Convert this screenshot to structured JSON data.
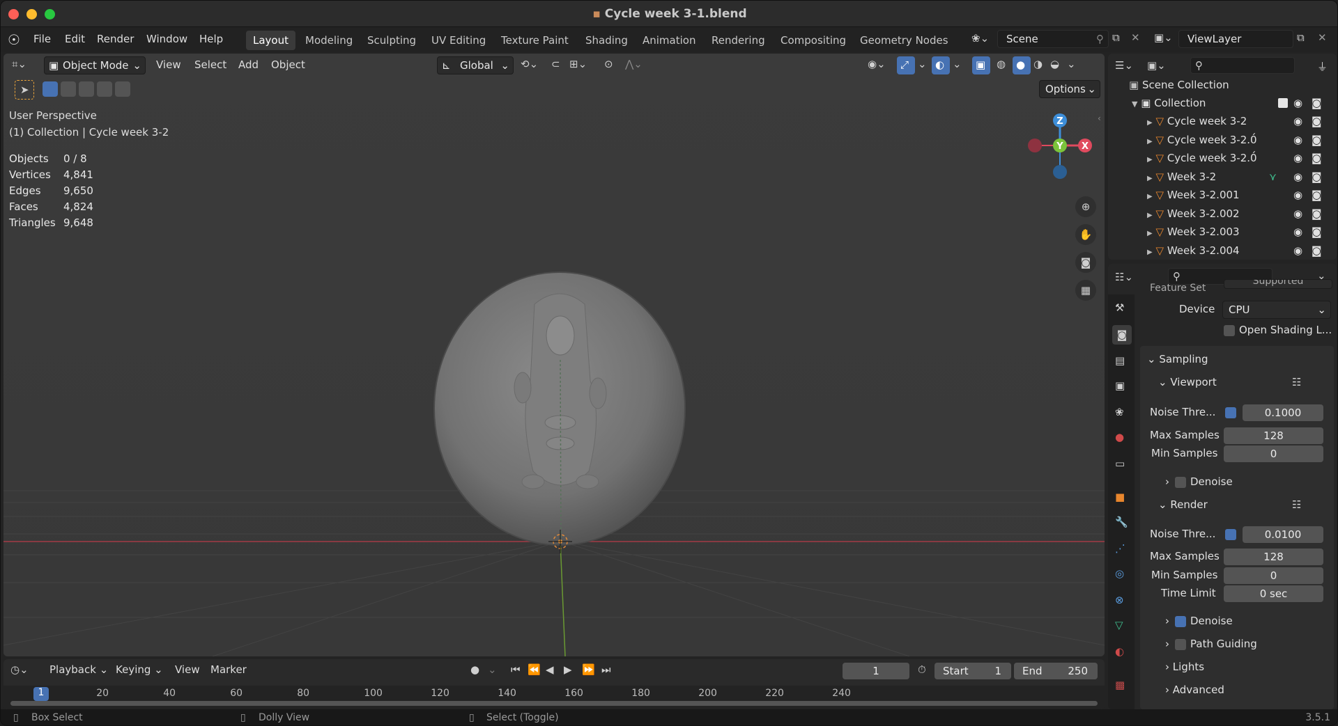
{
  "window": {
    "title": "Cycle week 3-1.blend"
  },
  "menus": [
    "File",
    "Edit",
    "Render",
    "Window",
    "Help"
  ],
  "workspaces": [
    "Layout",
    "Modeling",
    "Sculpting",
    "UV Editing",
    "Texture Paint",
    "Shading",
    "Animation",
    "Rendering",
    "Compositing",
    "Geometry Nodes"
  ],
  "active_workspace": "Layout",
  "scene": {
    "name": "Scene"
  },
  "view_layer": {
    "name": "ViewLayer"
  },
  "viewport": {
    "mode": "Object Mode",
    "menus": [
      "View",
      "Select",
      "Add",
      "Object"
    ],
    "transform_orientation": "Global",
    "options_label": "Options",
    "perspective_label": "User Perspective",
    "collection_label": "(1) Collection | Cycle week 3-2",
    "stats": [
      {
        "label": "Objects",
        "value": "0 / 8"
      },
      {
        "label": "Vertices",
        "value": "4,841"
      },
      {
        "label": "Edges",
        "value": "9,650"
      },
      {
        "label": "Faces",
        "value": "4,824"
      },
      {
        "label": "Triangles",
        "value": "9,648"
      }
    ],
    "gizmo": {
      "z": "Z",
      "y": "Y",
      "x": "X"
    }
  },
  "outliner": {
    "scene_collection": "Scene Collection",
    "collection": "Collection",
    "items": [
      "Cycle week 3-2",
      "Cycle week 3-2.0́",
      "Cycle week 3-2.0́",
      "Week 3-2",
      "Week 3-2.001",
      "Week 3-2.002",
      "Week 3-2.003",
      "Week 3-2.004"
    ]
  },
  "properties": {
    "feature_set_label": "Feature Set",
    "feature_set_value": "Supported",
    "device_label": "Device",
    "device_value": "CPU",
    "osl_label": "Open Shading L...",
    "sampling": "Sampling",
    "viewport_section": "Viewport",
    "viewport_noise_label": "Noise Thre...",
    "viewport_noise_value": "0.1000",
    "viewport_max_label": "Max Samples",
    "viewport_max_value": "128",
    "viewport_min_label": "Min Samples",
    "viewport_min_value": "0",
    "viewport_denoise": "Denoise",
    "render_section": "Render",
    "render_noise_label": "Noise Thre...",
    "render_noise_value": "0.0100",
    "render_max_label": "Max Samples",
    "render_max_value": "128",
    "render_min_label": "Min Samples",
    "render_min_value": "0",
    "time_limit_label": "Time Limit",
    "time_limit_value": "0 sec",
    "render_denoise": "Denoise",
    "path_guiding": "Path Guiding",
    "lights": "Lights",
    "advanced": "Advanced"
  },
  "timeline": {
    "menus": [
      "Playback",
      "Keying",
      "View",
      "Marker"
    ],
    "current_frame": "1",
    "start_label": "Start",
    "start_value": "1",
    "end_label": "End",
    "end_value": "250",
    "ruler": [
      "1",
      "20",
      "40",
      "60",
      "80",
      "100",
      "120",
      "140",
      "160",
      "180",
      "200",
      "220",
      "240"
    ]
  },
  "statusbar": {
    "box_select": "Box Select",
    "dolly_view": "Dolly View",
    "select_toggle": "Select (Toggle)",
    "version": "3.5.1"
  },
  "colors": {
    "accent": "#4772b3",
    "x_axis": "#e04a5e",
    "y_axis": "#7bc33b",
    "z_axis": "#3d8ed9",
    "orange": "#e8862d"
  }
}
